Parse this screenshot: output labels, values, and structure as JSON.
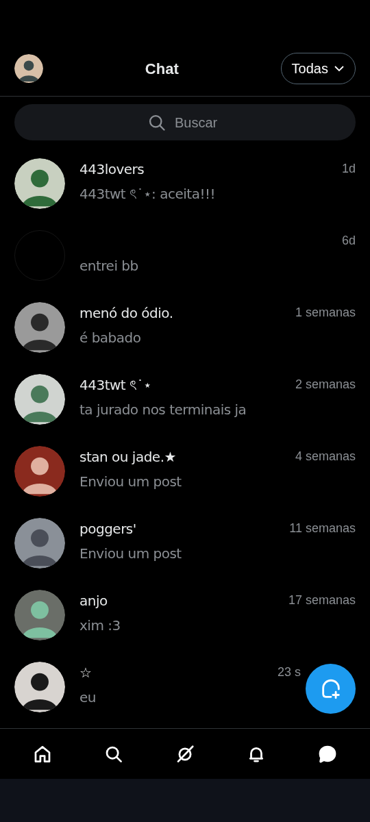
{
  "header": {
    "title": "Chat",
    "filter": "Todas"
  },
  "search": {
    "placeholder": "Buscar"
  },
  "conversations": [
    {
      "name": "443lovers",
      "preview": "443twt ৎ˙⋆: aceita!!!",
      "time": "1d",
      "has_photo": true
    },
    {
      "preview": "entrei bb",
      "time": "6d",
      "has_photo": false
    },
    {
      "name": "menó do ódio.",
      "preview": "é babado",
      "time": "1 semanas",
      "has_photo": true
    },
    {
      "name": "443twt ৎ˙⋆",
      "preview": "ta jurado nos terminais ja",
      "time": "2 semanas",
      "has_photo": true
    },
    {
      "name": "stan ou jade.★",
      "preview": "Enviou um post",
      "time": "4 semanas",
      "has_photo": true
    },
    {
      "name": "poggers'",
      "preview": "Enviou um post",
      "time": "11 semanas",
      "has_photo": true
    },
    {
      "name": "anjo",
      "preview": "xim :3",
      "time": "17 semanas",
      "has_photo": true
    },
    {
      "name": "☆",
      "preview": "eu",
      "time": "23 s",
      "has_photo": true
    }
  ],
  "bottom_nav": [
    {
      "kind": "home",
      "selected": false
    },
    {
      "kind": "search",
      "selected": false
    },
    {
      "kind": "slash",
      "selected": false
    },
    {
      "kind": "bell",
      "selected": false
    },
    {
      "kind": "chat",
      "selected": true
    }
  ]
}
